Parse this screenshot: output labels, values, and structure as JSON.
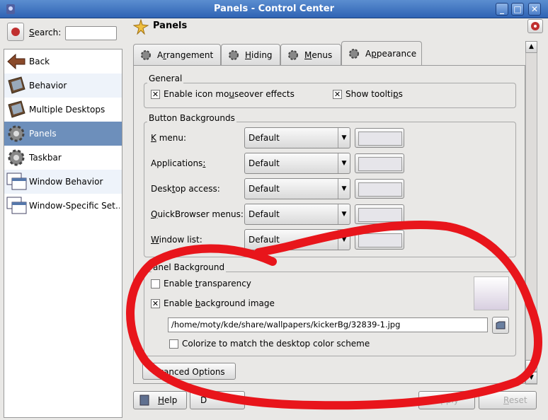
{
  "window": {
    "title": "Panels - Control Center",
    "controls": [
      "_",
      "□",
      "✕"
    ]
  },
  "search": {
    "label_pre": "",
    "label_u": "S",
    "label_post": "earch:",
    "value": ""
  },
  "sidebar": {
    "items": [
      {
        "label": "Back",
        "icon": "back-arrow-icon"
      },
      {
        "label": "Behavior",
        "icon": "kde-monitor-icon"
      },
      {
        "label": "Multiple Desktops",
        "icon": "kde-monitor-icon"
      },
      {
        "label": "Panels",
        "icon": "gear-icon"
      },
      {
        "label": "Taskbar",
        "icon": "gear-icon"
      },
      {
        "label": "Window Behavior",
        "icon": "window-icon"
      },
      {
        "label": "Window-Specific Set…",
        "icon": "window-icon"
      }
    ],
    "selected": "Panels"
  },
  "header": {
    "title": "Panels"
  },
  "tabs": [
    {
      "pre": "A",
      "u": "r",
      "post": "rangement"
    },
    {
      "pre": "",
      "u": "H",
      "post": "iding"
    },
    {
      "pre": "",
      "u": "M",
      "post": "enus"
    },
    {
      "pre": "A",
      "u": "p",
      "post": "pearance"
    }
  ],
  "active_tab": "Appearance",
  "general": {
    "title": "General",
    "mouseover": {
      "pre": "Enable icon mo",
      "u": "u",
      "post": "seover effects",
      "checked": true
    },
    "tooltips": {
      "pre": "Show toolti",
      "u": "p",
      "post": "s",
      "checked": true
    }
  },
  "button_backgrounds": {
    "title": "Button Backgrounds",
    "rows": [
      {
        "pre": "",
        "u": "K",
        "post": " menu:",
        "value": "Default"
      },
      {
        "pre": "Applications",
        "u": ":",
        "post": "",
        "value": "Default"
      },
      {
        "pre": "Desk",
        "u": "t",
        "post": "op access:",
        "value": "Default"
      },
      {
        "pre": "",
        "u": "Q",
        "post": "uickBrowser menus:",
        "value": "Default"
      },
      {
        "pre": "",
        "u": "W",
        "post": "indow list:",
        "value": "Default"
      }
    ]
  },
  "panel_background": {
    "title": "anel Background",
    "transparency": {
      "pre": "Enable ",
      "u": "t",
      "post": "ransparency",
      "checked": false
    },
    "bg_image": {
      "pre": "Enable ",
      "u": "b",
      "post": "ackground image",
      "checked": true
    },
    "path": "/home/moty/kde/share/wallpapers/kickerBg/32839-1.jpg",
    "colorize": {
      "label": "Colorize to match the desktop color scheme",
      "checked": false
    }
  },
  "advanced_button": "dvanced Options",
  "bottom": {
    "help_u": "H",
    "help_post": "elp",
    "default_label": "D",
    "apply_label": "Apply",
    "reset_u": "R",
    "reset_post": "eset"
  },
  "colors": {
    "titlebar": "#2f63b4",
    "selection": "#6d8fbb",
    "annotation": "#e8151b"
  }
}
